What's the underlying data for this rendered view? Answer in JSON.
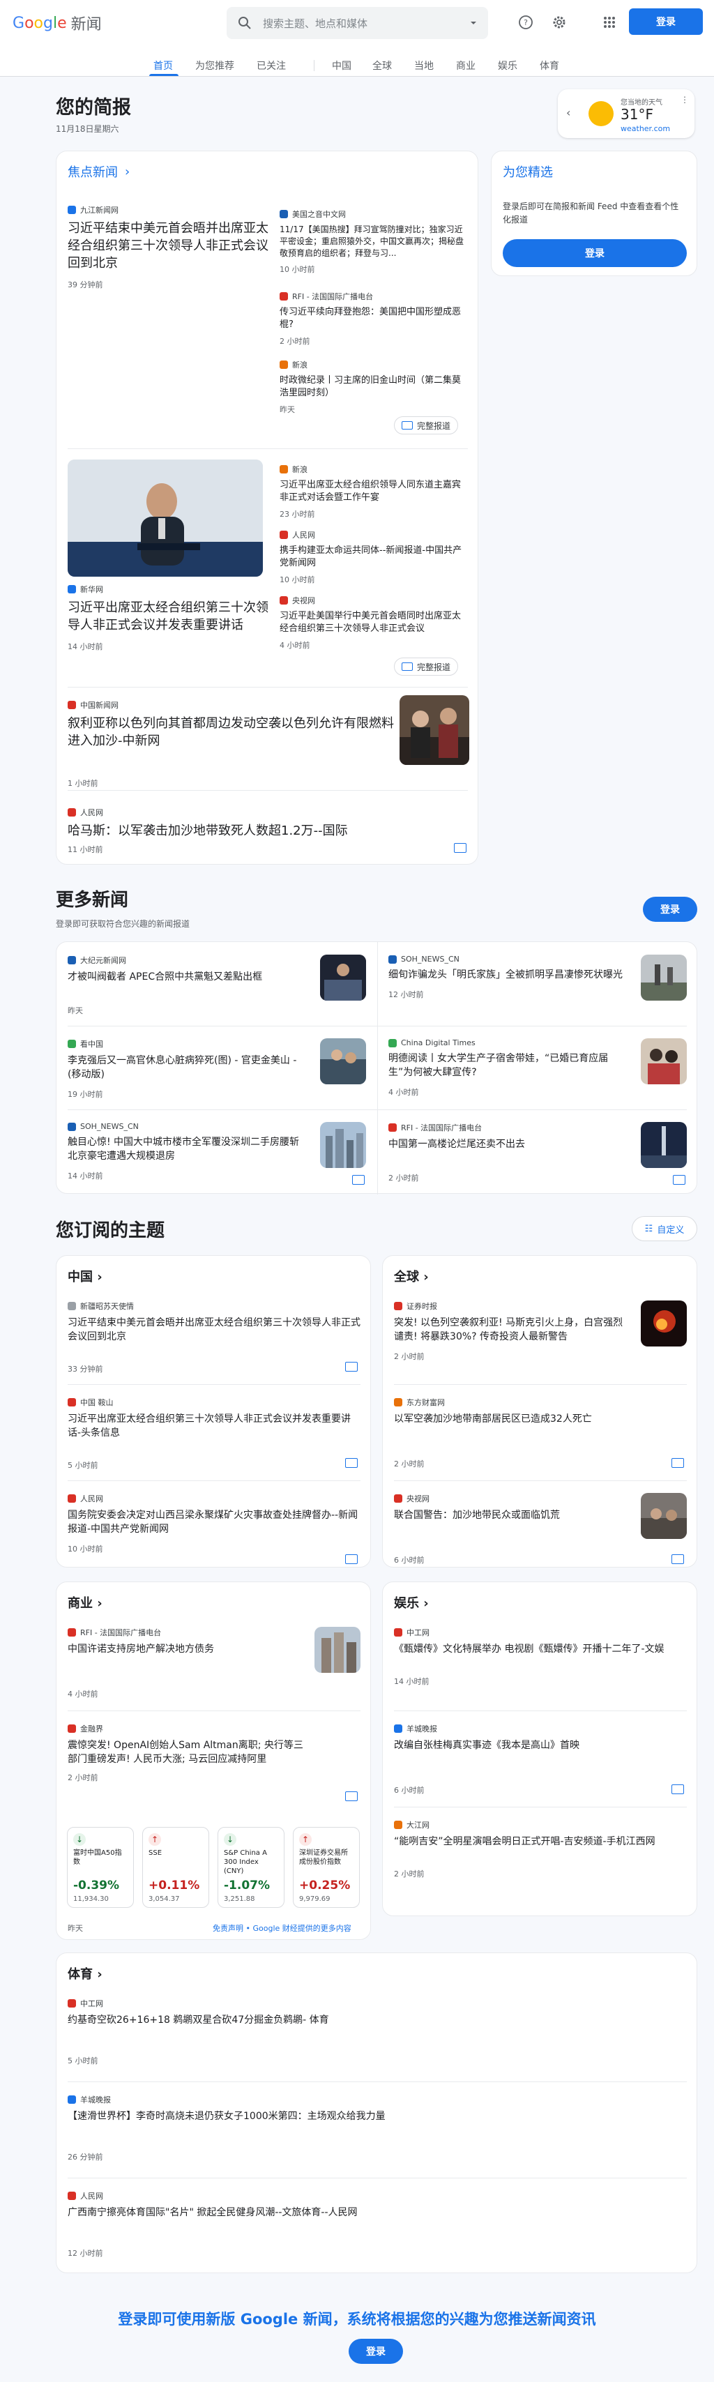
{
  "header": {
    "logo_google": "Google",
    "logo_news": "新闻",
    "search_placeholder": "搜索主题、地点和媒体",
    "login": "登录"
  },
  "tabs": [
    "首页",
    "为您推荐",
    "已关注",
    "中国",
    "全球",
    "当地",
    "商业",
    "娱乐",
    "体育"
  ],
  "briefing": {
    "title": "您的简报",
    "date": "11月18日星期六"
  },
  "weather": {
    "label": "您当地的天气",
    "temp": "31°F",
    "source": "weather.com"
  },
  "top": {
    "title": "焦点新闻",
    "s1": {
      "main": {
        "source": "九江新闻网",
        "headline": "习近平结束中美元首会晤并出席亚太经合组织第三十次领导人非正式会议回到北京",
        "time": "39 分钟前"
      },
      "side": [
        {
          "source": "美国之音中文网",
          "headline": "11/17【美国热搜】拜习宣驾防撞对比；独家习近平密设金；重启照猿外交，中国文赢再次；揭秘盘敬预育启的组织者；拜登与习...",
          "time": "10 小时前"
        },
        {
          "source": "RFI - 法国国际广播电台",
          "headline": "传习近平续向拜登抱怨：美国把中国形塑成恶棍?",
          "time": "2 小时前"
        },
        {
          "source": "新浪",
          "headline": "时政微纪录丨习主席的旧金山时间（第二集莫浩里园时刻）",
          "time": "昨天"
        }
      ],
      "full": "完整报道"
    },
    "s2": {
      "main": {
        "source": "新华网",
        "headline": "习近平出席亚太经合组织第三十次领导人非正式会议并发表重要讲话",
        "time": "14 小时前"
      },
      "side": [
        {
          "source": "新浪",
          "headline": "习近平出席亚太经合组织领导人同东道主嘉宾非正式对话会暨工作午宴",
          "time": "23 小时前"
        },
        {
          "source": "人民网",
          "headline": "携手构建亚太命运共同体--新闻报道-中国共产党新闻网",
          "time": "10 小时前"
        },
        {
          "source": "央视网",
          "headline": "习近平赴美国举行中美元首会晤同时出席亚太经合组织第三十次领导人非正式会议",
          "time": "4 小时前"
        }
      ],
      "full": "完整报道"
    },
    "s3": {
      "source": "中国新闻网",
      "headline": "叙利亚称以色列向其首都周边发动空袭以色列允许有限燃料进入加沙-中新网",
      "time": "1 小时前"
    },
    "s4": {
      "source": "人民网",
      "headline": "哈马斯：以军袭击加沙地带致死人数超1.2万--国际",
      "time": "11 小时前"
    }
  },
  "picks": {
    "title": "为您精选",
    "desc": "登录后即可在简报和新闻 Feed 中查看查看个性化报道",
    "login": "登录"
  },
  "more": {
    "title": "更多新闻",
    "desc": "登录即可获取符合您兴趣的新闻报道",
    "login": "登录",
    "items": [
      {
        "source": "大纪元新闻网",
        "headline": "才被叫阀截者 APEC合照中共黨魁又差點出框",
        "time": "昨天"
      },
      {
        "source": "SOH_NEWS_CN",
        "headline": "细旬诈骗龙头「明氏家族」全被抓明孚昌凄惨死状曝光",
        "time": "12 小时前"
      },
      {
        "source": "看中国",
        "headline": "李克强后又一高官休息心脏病猝死(图) - 官吏金美山 - (移动版)",
        "time": "19 小时前"
      },
      {
        "source": "China Digital Times",
        "headline": "明德阅读丨女大学生产子宿舍带娃，“已婚已育应届生”为何被大肆宣传?",
        "time": "4 小时前"
      },
      {
        "source": "SOH_NEWS_CN",
        "headline": "触目心惊! 中国大中城市楼市全军覆没深圳二手房腰斩北京豪宅遭遇大规模退房",
        "time": "14 小时前"
      },
      {
        "source": "RFI - 法国国际广播电台",
        "headline": "中国第一高楼论烂尾还卖不出去",
        "time": "2 小时前"
      }
    ]
  },
  "topics": {
    "title": "您订阅的主题",
    "customize": "自定义",
    "china": {
      "title": "中国",
      "items": [
        {
          "source": "新疆昭苏天使情",
          "headline": "习近平结束中美元首会晤并出席亚太经合组织第三十次领导人非正式会议回到北京",
          "time": "33 分钟前"
        },
        {
          "source": "中国 鞍山",
          "headline": "习近平出席亚太经合组织第三十次领导人非正式会议并发表重要讲话-头条信息",
          "time": "5 小时前"
        },
        {
          "source": "人民网",
          "headline": "国务院安委会决定对山西吕梁永聚煤矿火灾事故查处挂牌督办--新闻报道-中国共产党新闻网",
          "time": "10 小时前"
        }
      ]
    },
    "world": {
      "title": "全球",
      "items": [
        {
          "source": "证券时报",
          "headline": "突发! 以色列空袭叙利亚! 马斯克引火上身，白宫强烈谴责! 将暴跌30%? 传奇投资人最新警告",
          "time": "2 小时前"
        },
        {
          "source": "东方财富网",
          "headline": "以军空袭加沙地带南部居民区已造成32人死亡",
          "time": "2 小时前"
        },
        {
          "source": "央视网",
          "headline": "联合国警告：加沙地带民众或面临饥荒",
          "time": "6 小时前"
        }
      ]
    },
    "business": {
      "title": "商业",
      "items": [
        {
          "source": "RFI - 法国国际广播电台",
          "headline": "中国许诺支持房地产解决地方债务",
          "time": "4 小时前"
        },
        {
          "source": "金融界",
          "headline": "震惊突发! OpenAI创始人Sam Altman离职; 央行等三部门重磅发声! 人民币大涨; 马云回应减持阿里",
          "time": "2 小时前"
        }
      ],
      "stocks": [
        {
          "name": "富时中国A50指数",
          "change": "-0.39%",
          "value": "11,934.30",
          "dir": "down"
        },
        {
          "name": "SSE",
          "change": "+0.11%",
          "value": "3,054.37",
          "dir": "up"
        },
        {
          "name": "S&P China A 300 Index (CNY)",
          "change": "-1.07%",
          "value": "3,251.88",
          "dir": "down"
        },
        {
          "name": "深圳证券交易所成份股价指数",
          "change": "+0.25%",
          "value": "9,979.69",
          "dir": "up"
        }
      ],
      "stocks_time": "昨天",
      "disclaimer": "免责声明 • Google 财经提供的更多内容"
    },
    "ent": {
      "title": "娱乐",
      "items": [
        {
          "source": "中工网",
          "headline": "《甄嬛传》文化特展举办 电视剧《甄嬛传》开播十二年了-文娱",
          "time": "14 小时前"
        },
        {
          "source": "羊城晚报",
          "headline": "改编自张桂梅真实事迹《我本是高山》首映",
          "time": "6 小时前"
        },
        {
          "source": "大江网",
          "headline": "“能咧吉安”全明星演唱会明日正式开唱-吉安频道-手机江西网",
          "time": "2 小时前"
        }
      ]
    },
    "sports": {
      "title": "体育",
      "items": [
        {
          "source": "中工网",
          "headline": "约基奇空砍26+16+18 鹈鹕双星合砍47分掘金负鹈鹕- 体育",
          "time": "5 小时前"
        },
        {
          "source": "羊城晚报",
          "headline": "【速滑世界杯】李奇时高烧未退仍获女子1000米第四：主场观众给我力量",
          "time": "26 分钟前"
        },
        {
          "source": "人民网",
          "headline": "广西南宁擦亮体育国际\"名片\" 掀起全民健身风潮--文旅体育--人民网",
          "time": "12 小时前"
        }
      ]
    }
  },
  "footer": {
    "text": "登录即可使用新版 Google 新闻，系统将根据您的兴趣为您推送新闻资讯",
    "login": "登录"
  }
}
